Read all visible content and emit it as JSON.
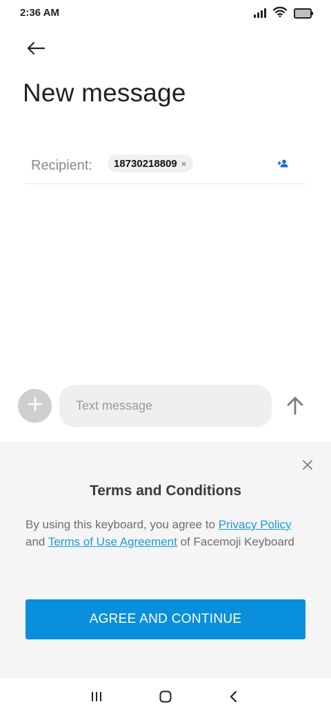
{
  "status_bar": {
    "time": "2:36 AM",
    "icons": [
      "signal-icon",
      "wifi-icon",
      "battery-icon"
    ]
  },
  "header": {
    "back_icon": "arrow-left-icon",
    "title": "New message"
  },
  "recipient": {
    "label": "Recipient:",
    "chip_number": "18730218809",
    "chip_remove": "×",
    "add_contact_icon": "add-contact-icon"
  },
  "compose": {
    "attach_icon": "plus-icon",
    "placeholder": "Text message",
    "value": "",
    "send_icon": "arrow-up-icon"
  },
  "terms": {
    "title": "Terms and Conditions",
    "text_1": "By using this keyboard, you agree to ",
    "privacy_link": "Privacy Policy",
    "text_2": " and ",
    "terms_link": "Terms of Use Agreement",
    "text_3": " of Facemoji Keyboard",
    "agree_button": "AGREE AND CONTINUE",
    "close_icon": "close-icon"
  },
  "nav_bar": {
    "icons": [
      "recent-apps-icon",
      "home-icon",
      "back-icon"
    ]
  },
  "colors": {
    "accent_blue": "#0a8fdc",
    "link_blue": "#1b9ae0",
    "contact_icon_blue": "#1565e0",
    "panel_bg": "#f5f5f5"
  }
}
